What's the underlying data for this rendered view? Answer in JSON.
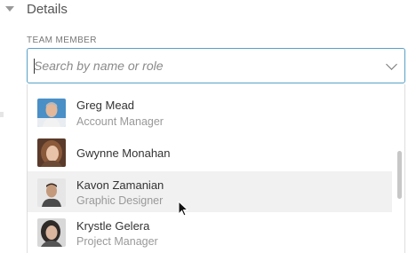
{
  "section": {
    "title": "Details"
  },
  "field": {
    "label": "TEAM MEMBER",
    "placeholder": "Search by name or role"
  },
  "options": [
    {
      "name": "Greg Mead",
      "role": "Account Manager"
    },
    {
      "name": "Gwynne Monahan",
      "role": ""
    },
    {
      "name": "Kavon Zamanian",
      "role": "Graphic Designer"
    },
    {
      "name": "Krystle Gelera",
      "role": "Project Manager"
    }
  ],
  "colors": {
    "focus_border": "#58a0c8",
    "hover_bg": "#f1f1f1"
  },
  "icons": {
    "caret": "caret-down-icon",
    "chevron": "chevron-down-icon",
    "pointer": "mouse-pointer-icon"
  }
}
